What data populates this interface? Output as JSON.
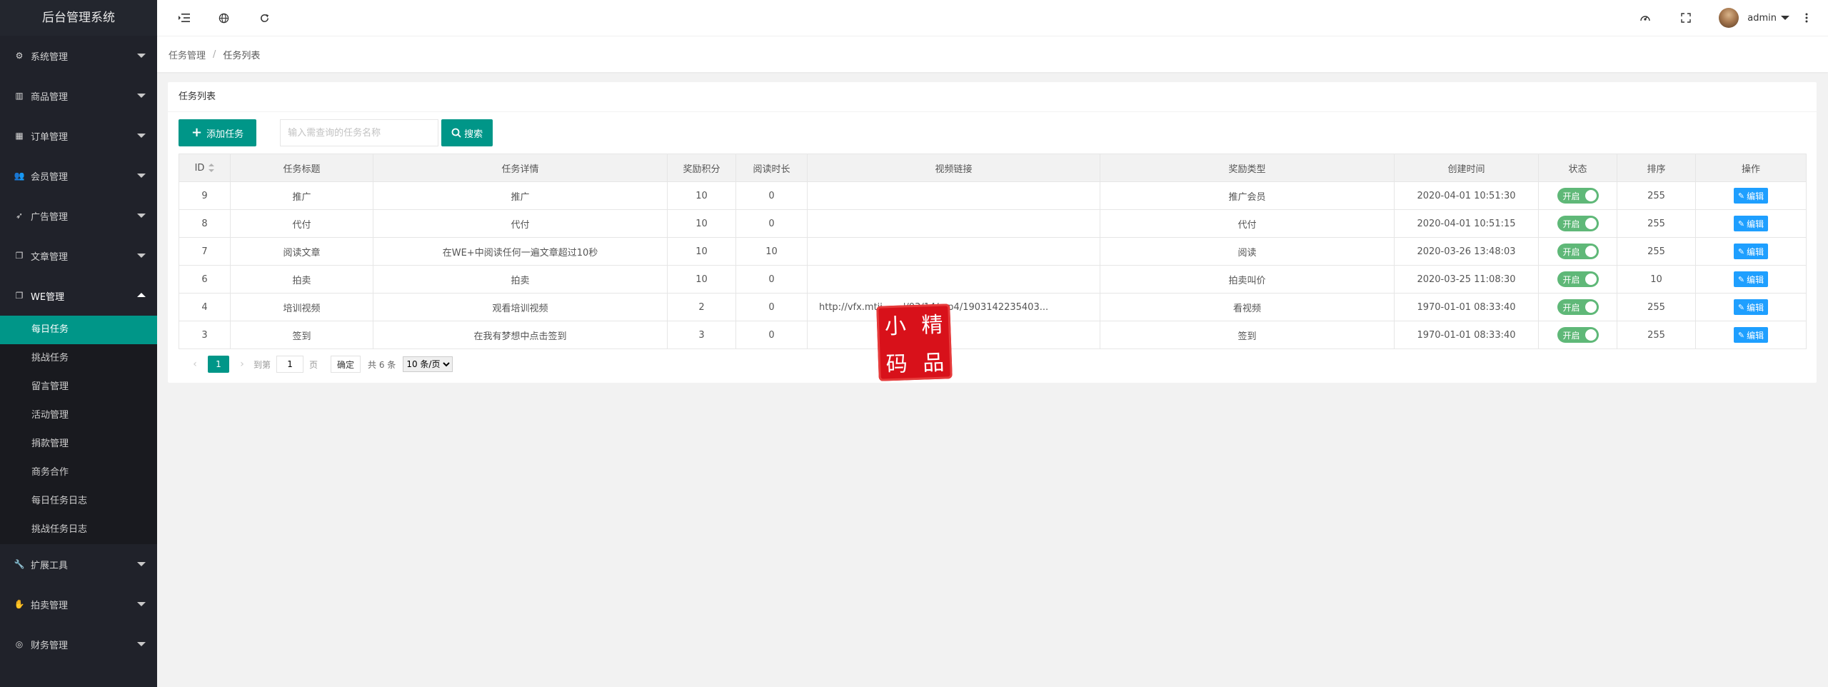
{
  "app": {
    "title": "后台管理系统"
  },
  "sidebar": {
    "items_top": [
      {
        "label": "系统管理",
        "icon": "gear-icon"
      },
      {
        "label": "商品管理",
        "icon": "bar-chart-icon"
      },
      {
        "label": "订单管理",
        "icon": "calendar-icon"
      },
      {
        "label": "会员管理",
        "icon": "users-icon"
      },
      {
        "label": "广告管理",
        "icon": "rocket-icon"
      },
      {
        "label": "文章管理",
        "icon": "copy-icon"
      }
    ],
    "open_item": {
      "label": "WE管理",
      "icon": "copy-icon"
    },
    "sub_items": [
      {
        "label": "每日任务",
        "active": true
      },
      {
        "label": "挑战任务"
      },
      {
        "label": "留言管理"
      },
      {
        "label": "活动管理"
      },
      {
        "label": "捐款管理"
      },
      {
        "label": "商务合作"
      },
      {
        "label": "每日任务日志"
      },
      {
        "label": "挑战任务日志"
      }
    ],
    "items_bottom": [
      {
        "label": "扩展工具",
        "icon": "wrench-icon"
      },
      {
        "label": "拍卖管理",
        "icon": "hand-icon"
      },
      {
        "label": "财务管理",
        "icon": "target-icon"
      }
    ]
  },
  "header": {
    "user_name": "admin"
  },
  "breadcrumb": {
    "parent": "任务管理",
    "separator": "/",
    "current": "任务列表"
  },
  "card": {
    "title": "任务列表",
    "add_button": "添加任务",
    "search_placeholder": "输入需查询的任务名称",
    "search_button": "搜索"
  },
  "table": {
    "columns": [
      "ID",
      "任务标题",
      "任务详情",
      "奖励积分",
      "阅读时长",
      "视频链接",
      "奖励类型",
      "创建时间",
      "状态",
      "排序",
      "操作"
    ],
    "rows": [
      {
        "id": "9",
        "title": "推广",
        "detail": "推广",
        "points": "10",
        "read_time": "0",
        "video": "",
        "reward_type": "推广会员",
        "created": "2020-04-01 10:51:30",
        "status": "开启",
        "sort": "255",
        "action": "编辑"
      },
      {
        "id": "8",
        "title": "代付",
        "detail": "代付",
        "points": "10",
        "read_time": "0",
        "video": "",
        "reward_type": "代付",
        "created": "2020-04-01 10:51:15",
        "status": "开启",
        "sort": "255",
        "action": "编辑"
      },
      {
        "id": "7",
        "title": "阅读文章",
        "detail": "在WE+中阅读任何一遍文章超过10秒",
        "points": "10",
        "read_time": "10",
        "video": "",
        "reward_type": "阅读",
        "created": "2020-03-26 13:48:03",
        "status": "开启",
        "sort": "255",
        "action": "编辑"
      },
      {
        "id": "6",
        "title": "拍卖",
        "detail": "拍卖",
        "points": "10",
        "read_time": "0",
        "video": "",
        "reward_type": "拍卖叫价",
        "created": "2020-03-25 11:08:30",
        "status": "开启",
        "sort": "10",
        "action": "编辑"
      },
      {
        "id": "4",
        "title": "培训视频",
        "detail": "观看培训视频",
        "points": "2",
        "read_time": "0",
        "video": "http://vfx.mtii...                 ...'/03/14/mp4/1903142235403...",
        "reward_type": "看视频",
        "created": "1970-01-01 08:33:40",
        "status": "开启",
        "sort": "255",
        "action": "编辑"
      },
      {
        "id": "3",
        "title": "签到",
        "detail": "在我有梦想中点击签到",
        "points": "3",
        "read_time": "0",
        "video": "",
        "reward_type": "签到",
        "created": "1970-01-01 08:33:40",
        "status": "开启",
        "sort": "255",
        "action": "编辑"
      }
    ]
  },
  "pager": {
    "prev": "‹",
    "current_page": "1",
    "next": "›",
    "goto_label": "到第",
    "goto_value": "1",
    "page_unit": "页",
    "confirm": "确定",
    "total": "共 6 条",
    "page_size": "10 条/页"
  },
  "watermark": {
    "chars": [
      "小",
      "精",
      "码",
      "品"
    ]
  },
  "colors": {
    "primary": "#009688",
    "sidebar_bg": "#20222a",
    "edit_blue": "#1e9fff",
    "switch_green": "#5fb878"
  }
}
